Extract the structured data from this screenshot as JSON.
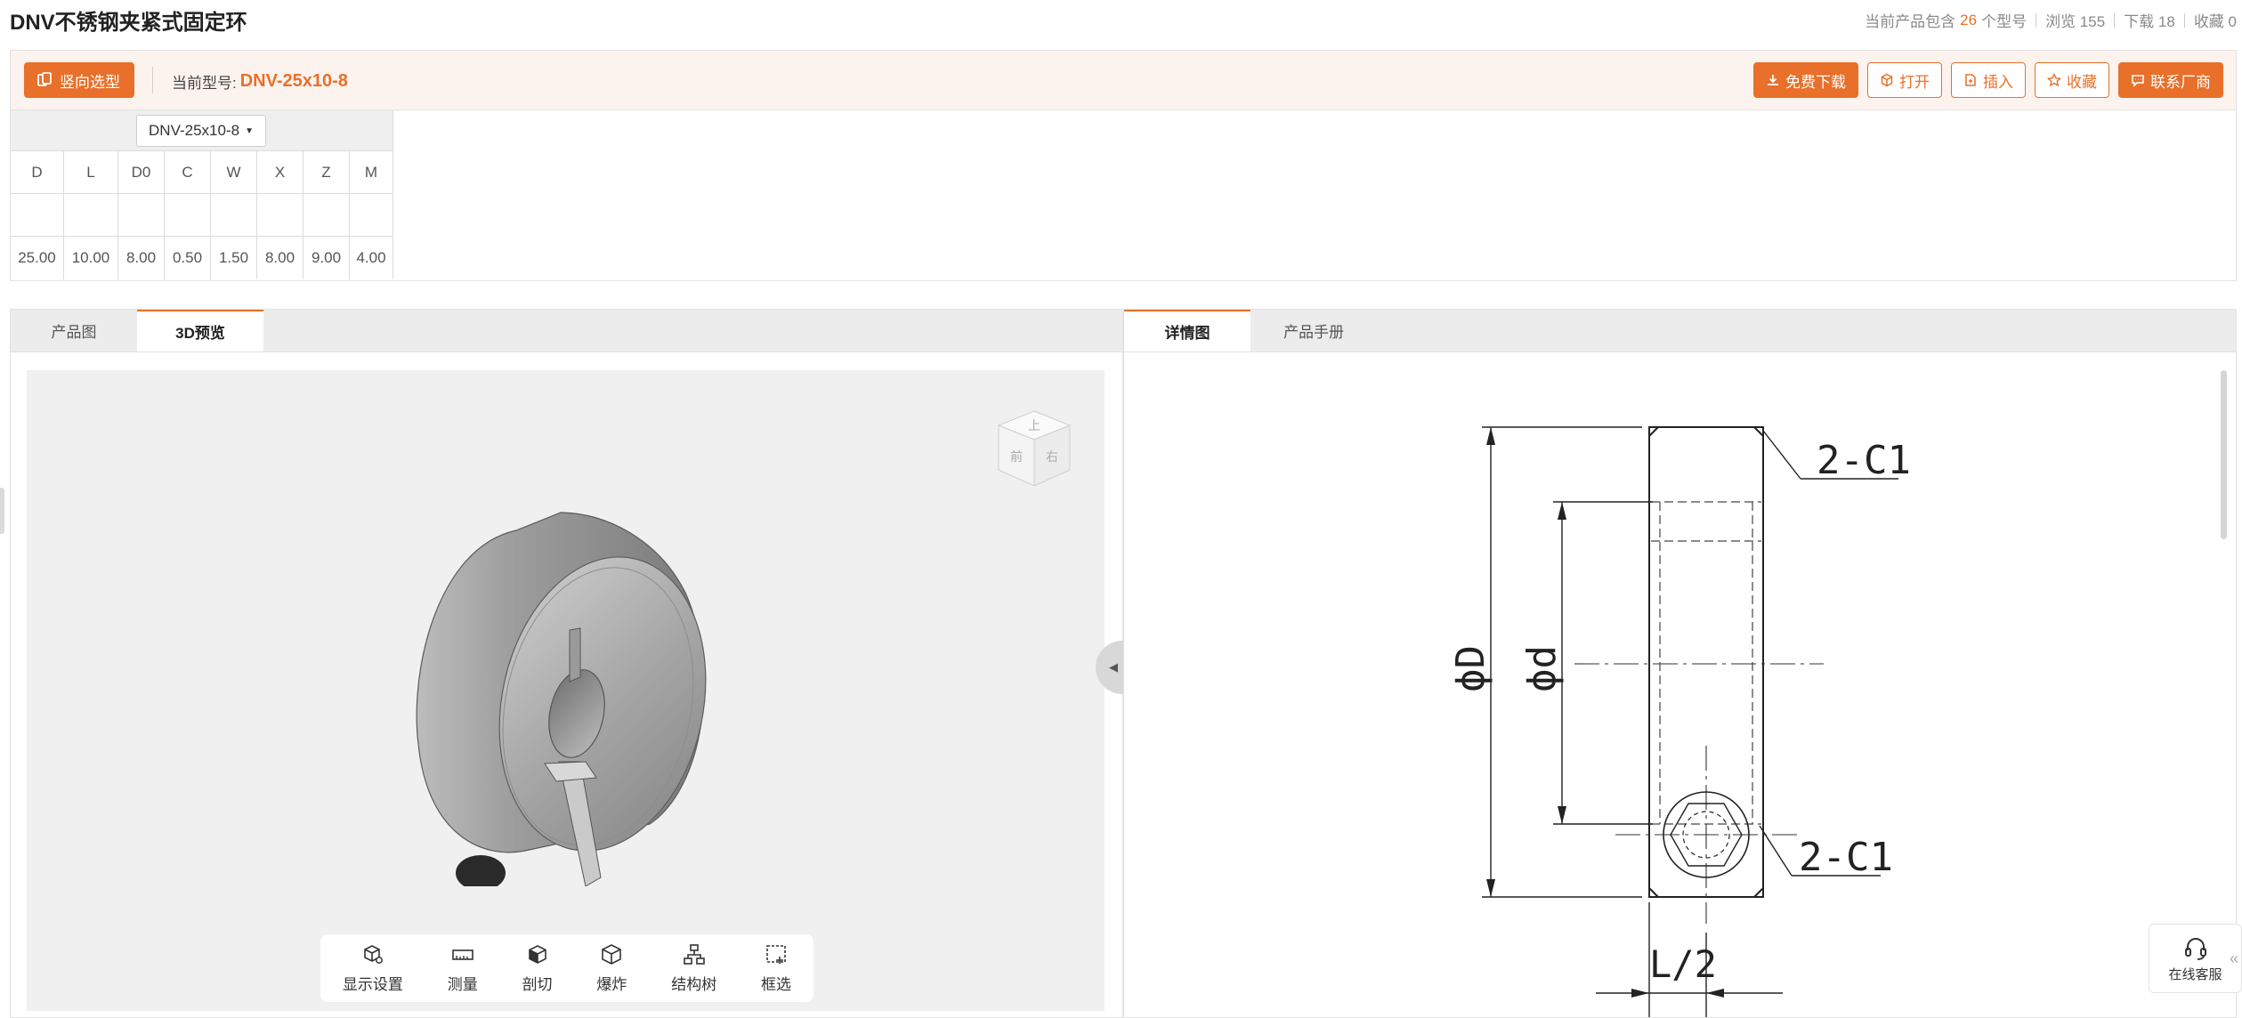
{
  "header": {
    "title": "DNV不锈钢夹紧式固定环",
    "stats": {
      "models_prefix": "当前产品包含",
      "models_count": "26",
      "models_suffix": "个型号",
      "views": "浏览 155",
      "downloads": "下载 18",
      "favorites": "收藏 0"
    }
  },
  "toolbar": {
    "reverse_select": "竖向选型",
    "current_model_label": "当前型号:",
    "current_model_value": "DNV-25x10-8",
    "actions": {
      "download": "免费下载",
      "open": "打开",
      "insert": "插入",
      "favorite": "收藏",
      "contact": "联系厂商"
    }
  },
  "params": {
    "select_value": "DNV-25x10-8",
    "columns": [
      "D",
      "L",
      "D0",
      "C",
      "W",
      "X",
      "Z",
      "M"
    ],
    "blank_row": [
      "",
      "",
      "",
      "",
      "",
      "",
      "",
      ""
    ],
    "values": [
      "25.00",
      "10.00",
      "8.00",
      "0.50",
      "1.50",
      "8.00",
      "9.00",
      "4.00"
    ]
  },
  "left_panel": {
    "tabs": [
      "产品图",
      "3D预览"
    ],
    "active_tab": "3D预览",
    "view_cube": {
      "top": "上",
      "front": "前",
      "right": "右"
    },
    "tools": [
      "显示设置",
      "测量",
      "剖切",
      "爆炸",
      "结构树",
      "框选"
    ]
  },
  "right_panel": {
    "tabs": [
      "详情图",
      "产品手册"
    ],
    "active_tab": "详情图",
    "drawing_labels": {
      "chamfer_top": "2-C1",
      "chamfer_bottom": "2-C1",
      "outer_dia": "ϕD",
      "inner_dia": "ϕd",
      "half_length": "L/2"
    }
  },
  "service": {
    "label": "在线客服"
  },
  "colors": {
    "accent": "#e8702a",
    "bar_bg": "#fdf3ee",
    "viewer_bg": "#f0f0f0"
  }
}
